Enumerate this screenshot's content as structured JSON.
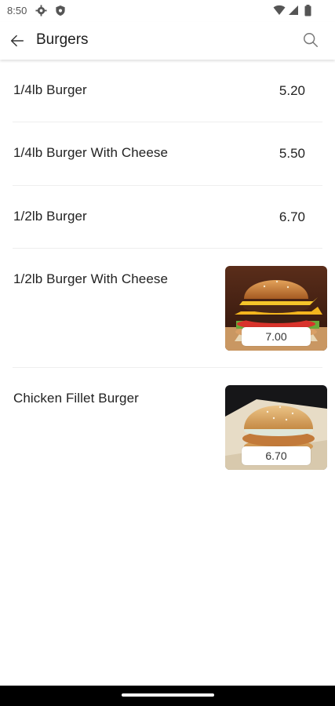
{
  "status_bar": {
    "time": "8:50",
    "icons": [
      "gear-icon",
      "shield-icon",
      "wifi-icon",
      "signal-icon",
      "battery-icon"
    ]
  },
  "app_bar": {
    "title": "Burgers",
    "back_icon": "arrow-left-icon",
    "search_icon": "search-icon"
  },
  "menu_items": [
    {
      "name": "1/4lb Burger",
      "price": "5.20"
    },
    {
      "name": "1/4lb Burger With Cheese",
      "price": "5.50"
    },
    {
      "name": "1/2lb Burger",
      "price": "6.70"
    },
    {
      "name": "1/2lb Burger With Cheese",
      "price": "7.00",
      "image": "cheeseburger-photo"
    },
    {
      "name": "Chicken Fillet Burger",
      "price": "6.70",
      "image": "chicken-burger-photo"
    }
  ],
  "colors": {
    "background": "#ffffff",
    "text": "#222222",
    "nav_bar": "#000000"
  }
}
